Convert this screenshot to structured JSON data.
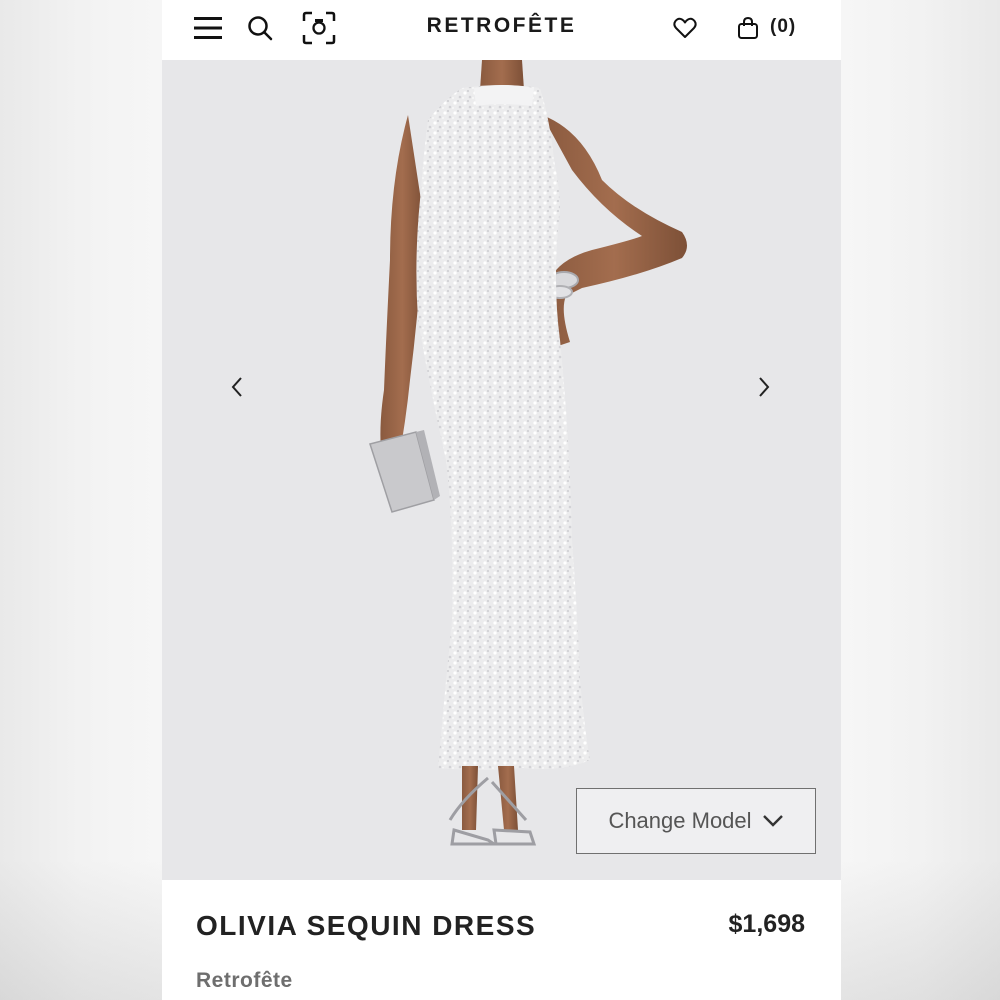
{
  "header": {
    "brand": "RETROFÊTE",
    "cart_count": "(0)",
    "icons": {
      "menu": "hamburger-menu-icon",
      "search": "search-icon",
      "visual_search": "camera-scan-icon",
      "wishlist": "heart-icon",
      "cart": "shopping-bag-icon"
    }
  },
  "media": {
    "change_model_label": "Change Model",
    "prev_icon": "chevron-left-icon",
    "next_icon": "chevron-right-icon"
  },
  "product": {
    "name": "OLIVIA SEQUIN DRESS",
    "price": "$1,698",
    "brand": "Retrofête"
  },
  "colors": {
    "text_primary": "#1a1a1a",
    "media_background": "#e7e7e9",
    "border": "#707070"
  }
}
